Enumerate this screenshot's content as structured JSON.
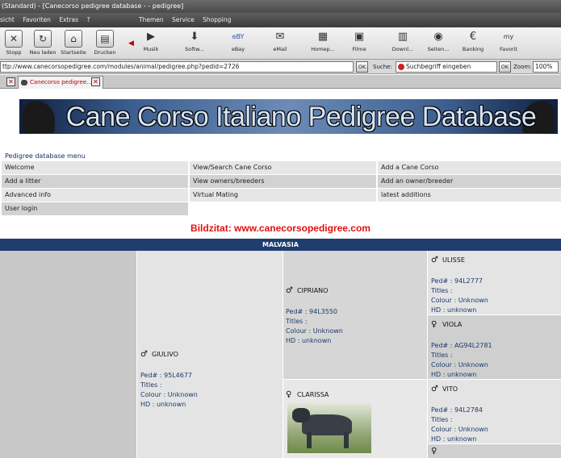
{
  "window": {
    "title": "(Standard) - [Canecorso pedigree database - - pedigree]"
  },
  "menubar": {
    "left_items": [
      "sicht",
      "Favoriten",
      "Extras",
      "?"
    ],
    "right_items": [
      "Themen",
      "Service",
      "Shopping"
    ]
  },
  "toolbar": {
    "buttons": [
      {
        "label": "Stopp",
        "icon": "stop-icon"
      },
      {
        "label": "Neu laden",
        "icon": "reload-icon"
      },
      {
        "label": "Startseite",
        "icon": "home-icon"
      },
      {
        "label": "Drucken",
        "icon": "print-icon"
      },
      {
        "label": "Musik",
        "icon": "play-icon"
      },
      {
        "label": "Softw...",
        "icon": "download-icon"
      },
      {
        "label": "eBay",
        "icon": "ebay-icon"
      },
      {
        "label": "eMail",
        "icon": "mail-icon"
      },
      {
        "label": "Homep...",
        "icon": "homepage-icon"
      },
      {
        "label": "Filme",
        "icon": "film-icon"
      },
      {
        "label": "Downl...",
        "icon": "document-icon"
      },
      {
        "label": "Seiten...",
        "icon": "globe-icon"
      },
      {
        "label": "Banking",
        "icon": "euro-icon"
      },
      {
        "label": "Favorit",
        "icon": "my-icon"
      }
    ]
  },
  "addressbar": {
    "url": "ttp://www.canecorsopedigree.com/modules/animal/pedigree.php?pedid=2726",
    "ok_label": "OK",
    "search_label": "Suche:",
    "search_placeholder": "Suchbegriff eingeben",
    "zoom_label": "Zoom:",
    "zoom_value": "100%"
  },
  "tabs": [
    {
      "label": "Canecorso pedigree..."
    }
  ],
  "page": {
    "banner_title": "Cane Corso Italiano Pedigree Database",
    "menu_heading": "Pedigree database menu",
    "menu_rows": [
      [
        "Welcome",
        "View/Search Cane Corso",
        "Add a Cane Corso"
      ],
      [
        "Add a litter",
        "View owners/breeders",
        "Add an owner/breeder"
      ],
      [
        "Advanced info",
        "Virtual Mating",
        "latest additions"
      ],
      [
        "User login",
        "",
        ""
      ]
    ],
    "credit": "Bildzitat: www.canecorsopedigree.com",
    "dog_name": "MALVASIA"
  },
  "pedigree": {
    "sex_male": "♂",
    "sex_female": "♀",
    "parent": {
      "name": "GIULIVO",
      "sex": "male",
      "ped": "Ped# : 95L4677",
      "titles": "Titles :",
      "colour": "Colour : Unknown",
      "hd": "HD : unknown"
    },
    "grandsire": {
      "name": "CIPRIANO",
      "sex": "male",
      "ped": "Ped# : 94L3550",
      "titles": "Titles :",
      "colour": "Colour : Unknown",
      "hd": "HD : unknown"
    },
    "granddam": {
      "name": "CLARISSA",
      "sex": "female"
    },
    "ggs1": {
      "name": "ULISSE",
      "sex": "male",
      "ped": "Ped# : 94L2777",
      "titles": "Titles :",
      "colour": "Colour : Unknown",
      "hd": "HD : unknown"
    },
    "ggd1": {
      "name": "VIOLA",
      "sex": "female",
      "ped": "Ped# : AG94L2781",
      "titles": "Titles :",
      "colour": "Colour : Unknown",
      "hd": "HD : unknown"
    },
    "ggs2": {
      "name": "VITO",
      "sex": "male",
      "ped": "Ped# : 94L2784",
      "titles": "Titles :",
      "colour": "Colour : Unknown",
      "hd": "HD : unknown"
    }
  }
}
